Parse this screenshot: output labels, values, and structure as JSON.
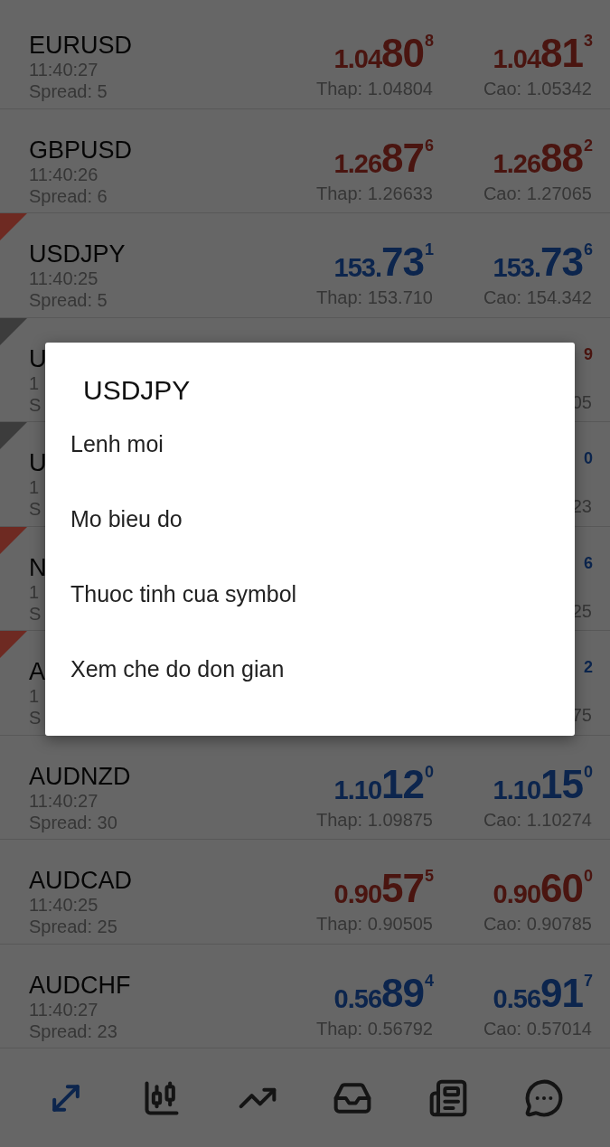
{
  "quotes": [
    {
      "kind": "full",
      "symbol": "EURUSD",
      "time": "11:40:27",
      "spread": "Spread: 5",
      "rising": false,
      "bid": {
        "head": "1.04",
        "big": "80",
        "sup": "8"
      },
      "ask": {
        "head": "1.04",
        "big": "81",
        "sup": "3"
      },
      "low": "Thap: 1.04804",
      "high": "Cao: 1.05342"
    },
    {
      "kind": "full",
      "symbol": "GBPUSD",
      "time": "11:40:26",
      "spread": "Spread: 6",
      "rising": false,
      "bid": {
        "head": "1.26",
        "big": "87",
        "sup": "6"
      },
      "ask": {
        "head": "1.26",
        "big": "88",
        "sup": "2"
      },
      "low": "Thap: 1.26633",
      "high": "Cao: 1.27065"
    },
    {
      "kind": "full",
      "symbol": "USDJPY",
      "time": "11:40:25",
      "spread": "Spread: 5",
      "flag": {
        "color": "#6e2a22"
      },
      "rising": true,
      "bid": {
        "head": "153.",
        "big": "73",
        "sup": "1"
      },
      "ask": {
        "head": "153.",
        "big": "73",
        "sup": "6"
      },
      "low": "Thap: 153.710",
      "high": "Cao: 154.342"
    },
    {
      "kind": "covered",
      "symbol": "U",
      "time": "1",
      "spread": "S",
      "flag": {
        "color": "#3c3c3c"
      },
      "rising": false,
      "ask_sup": "9",
      "high_tail": "05"
    },
    {
      "kind": "covered",
      "symbol": "U",
      "time": "1",
      "spread": "S",
      "flag": {
        "color": "#3c3c3c"
      },
      "rising": true,
      "ask_sup": "0",
      "high_tail": "23"
    },
    {
      "kind": "covered",
      "symbol": "N",
      "time": "1",
      "spread": "S",
      "flag": {
        "color": "#6e2a22"
      },
      "rising": true,
      "ask_sup": "6",
      "high_tail": "25"
    },
    {
      "kind": "covered",
      "symbol": "A",
      "time": "1",
      "spread": "S",
      "flag": {
        "color": "#6e2a22"
      },
      "rising": true,
      "ask_sup": "2",
      "high_tail": "75"
    },
    {
      "kind": "full",
      "symbol": "AUDNZD",
      "time": "11:40:27",
      "spread": "Spread: 30",
      "rising": true,
      "bid": {
        "head": "1.10",
        "big": "12",
        "sup": "0"
      },
      "ask": {
        "head": "1.10",
        "big": "15",
        "sup": "0"
      },
      "low": "Thap: 1.09875",
      "high": "Cao: 1.10274"
    },
    {
      "kind": "full",
      "symbol": "AUDCAD",
      "time": "11:40:25",
      "spread": "Spread: 25",
      "rising": false,
      "bid": {
        "head": "0.90",
        "big": "57",
        "sup": "5"
      },
      "ask": {
        "head": "0.90",
        "big": "60",
        "sup": "0"
      },
      "low": "Thap: 0.90505",
      "high": "Cao: 0.90785"
    },
    {
      "kind": "full",
      "symbol": "AUDCHF",
      "time": "11:40:27",
      "spread": "Spread: 23",
      "rising": true,
      "bid": {
        "head": "0.56",
        "big": "89",
        "sup": "4"
      },
      "ask": {
        "head": "0.56",
        "big": "91",
        "sup": "7"
      },
      "low": "Thap: 0.56792",
      "high": "Cao: 0.57014"
    }
  ],
  "nav": [
    {
      "selected": true
    },
    {
      "selected": false
    },
    {
      "selected": false
    },
    {
      "selected": false
    },
    {
      "selected": false
    },
    {
      "selected": false
    }
  ],
  "dialog": {
    "title": "USDJPY",
    "items": [
      "Lenh moi",
      "Mo bieu do",
      "Thuoc tinh cua symbol",
      "Xem che do don gian"
    ]
  }
}
